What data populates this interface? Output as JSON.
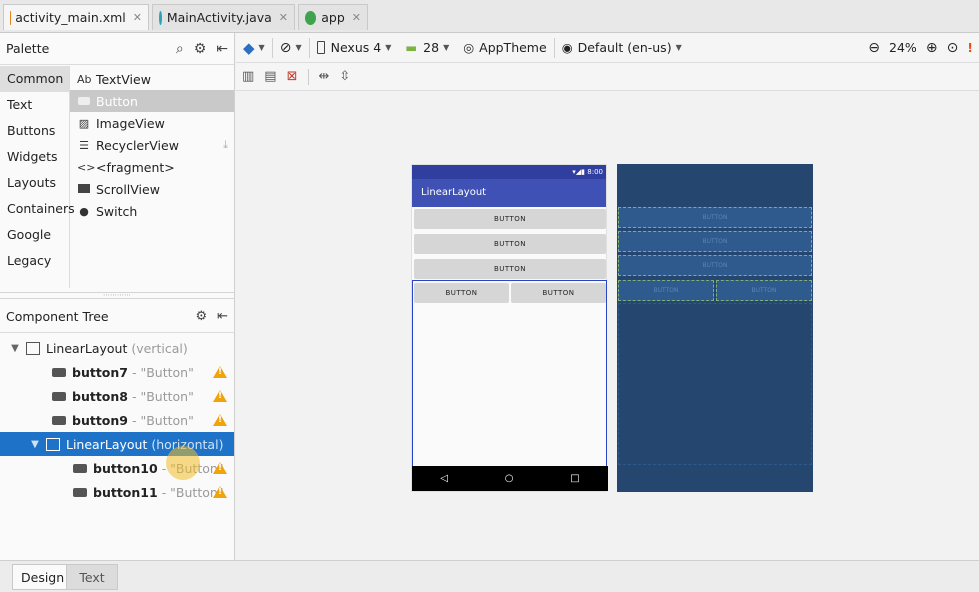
{
  "tabs": [
    {
      "label": "activity_main.xml",
      "active": true,
      "icon": "xml-file-icon",
      "color": "#e3851f"
    },
    {
      "label": "MainActivity.java",
      "active": false,
      "icon": "java-class-icon",
      "color": "#2aa3b5"
    },
    {
      "label": "app",
      "active": false,
      "icon": "android-module-icon",
      "color": "#3fa34d"
    }
  ],
  "palette": {
    "title": "Palette",
    "categories": [
      "Common",
      "Text",
      "Buttons",
      "Widgets",
      "Layouts",
      "Containers",
      "Google",
      "Legacy"
    ],
    "selected_category": "Common",
    "items": [
      {
        "label": "TextView",
        "icon_text": "Ab"
      },
      {
        "label": "Button",
        "icon_text": ""
      },
      {
        "label": "ImageView",
        "icon_text": ""
      },
      {
        "label": "RecyclerView",
        "icon_text": "☰"
      },
      {
        "label": "<fragment>",
        "icon_text": "<>"
      },
      {
        "label": "ScrollView",
        "icon_text": ""
      },
      {
        "label": "Switch",
        "icon_text": "●"
      }
    ]
  },
  "component_tree": {
    "title": "Component Tree",
    "rows": [
      {
        "name": "LinearLayout",
        "detail": "(vertical)",
        "bold": false
      },
      {
        "name": "button7",
        "detail": "- \"Button\"",
        "bold": true
      },
      {
        "name": "button8",
        "detail": "- \"Button\"",
        "bold": true
      },
      {
        "name": "button9",
        "detail": "- \"Button\"",
        "bold": true
      },
      {
        "name": "LinearLayout",
        "detail": "(horizontal)",
        "bold": false
      },
      {
        "name": "button10",
        "detail": "- \"Button\"",
        "bold": true
      },
      {
        "name": "button11",
        "detail": "- \"Button\"",
        "bold": true
      }
    ]
  },
  "toolbar": {
    "device": "Nexus 4",
    "api": "28",
    "theme": "AppTheme",
    "locale": "Default (en-us)",
    "zoom": "24%"
  },
  "preview": {
    "status_time": "8:00",
    "app_title": "LinearLayout",
    "button_label": "BUTTON",
    "blueprint_button_label": "BUTTON"
  },
  "bottom_tabs": {
    "design": "Design",
    "text": "Text"
  },
  "colors": {
    "accent": "#1e73c9",
    "app_bar": "#3f51b5",
    "status_bar": "#303f9f",
    "warning": "#f0a30a",
    "blueprint": "#25466e"
  }
}
